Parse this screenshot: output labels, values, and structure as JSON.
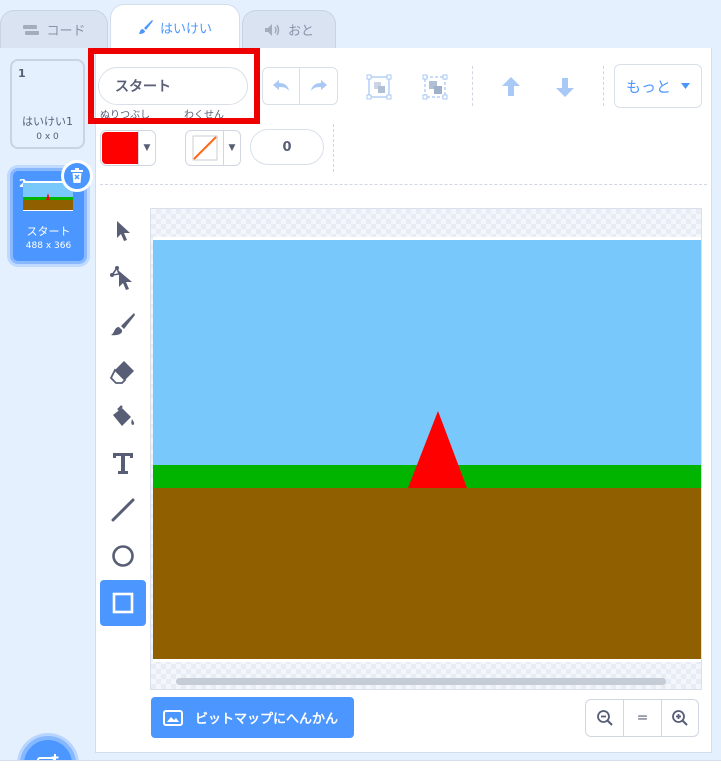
{
  "tabs": [
    {
      "label": "コード",
      "icon": "code-icon"
    },
    {
      "label": "はいけい",
      "icon": "paintbrush-icon",
      "active": true
    },
    {
      "label": "おと",
      "icon": "speaker-icon"
    }
  ],
  "costumes": [
    {
      "number": "1",
      "name": "はいけい1",
      "size": "0 x 0"
    },
    {
      "number": "2",
      "name": "スタート",
      "size": "488 x 366",
      "selected": true
    }
  ],
  "toolbar": {
    "name_value": "スタート",
    "fill_label": "ぬりつぶし",
    "outline_label": "わくせん",
    "outline_width": "0",
    "more_label": "もっと",
    "fill_color": "#ff0000"
  },
  "tools": [
    "select-icon",
    "reshape-icon",
    "brush-icon",
    "eraser-icon",
    "fill-icon",
    "text-icon",
    "line-icon",
    "circle-icon",
    "rectangle-icon"
  ],
  "bottom": {
    "bitmap_label": "ビットマップにへんかん",
    "zoom_reset": "="
  },
  "colors": {
    "accent": "#4c97ff",
    "sky": "#79c8fb",
    "grass": "#00b400",
    "ground": "#8f5f00",
    "triangle": "#ff0000",
    "highlight": "#ee0000"
  }
}
